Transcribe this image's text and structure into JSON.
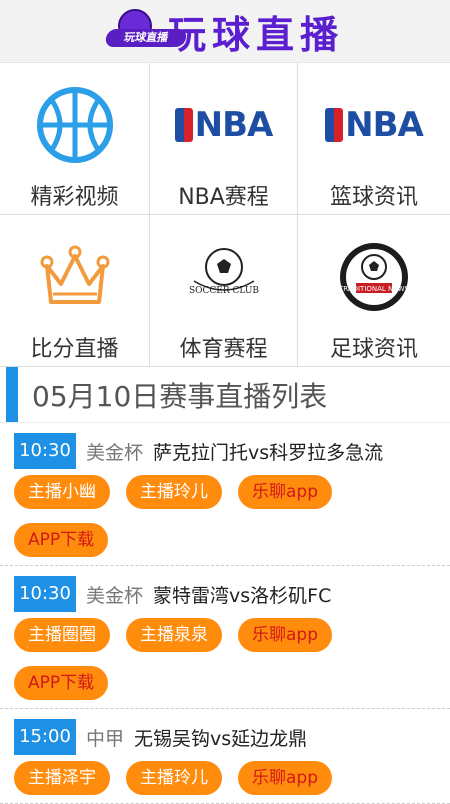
{
  "header": {
    "logo_text": "玩球直播",
    "title": "玩球直播"
  },
  "grid": [
    {
      "label": "精彩视频",
      "icon": "basketball-icon"
    },
    {
      "label": "NBA赛程",
      "icon": "nba-logo-icon",
      "logo_text": "NBA"
    },
    {
      "label": "篮球资讯",
      "icon": "nba-logo-icon",
      "logo_text": "NBA"
    },
    {
      "label": "比分直播",
      "icon": "crown-icon"
    },
    {
      "label": "体育赛程",
      "icon": "soccer-club-icon",
      "badge_text": "SOCCER CLUB"
    },
    {
      "label": "足球资讯",
      "icon": "soccer-news-icon",
      "badge_text": "TRADITIONAL NEWS"
    }
  ],
  "section": {
    "title": "05月10日赛事直播列表"
  },
  "matches": [
    {
      "time": "10:30",
      "league": "美金杯",
      "teams": "萨克拉门托vs科罗拉多急流",
      "tags": [
        "主播小幽",
        "主播玲儿",
        "乐聊app",
        "APP下载"
      ]
    },
    {
      "time": "10:30",
      "league": "美金杯",
      "teams": "蒙特雷湾vs洛杉矶FC",
      "tags": [
        "主播圈圈",
        "主播泉泉",
        "乐聊app",
        "APP下载"
      ]
    },
    {
      "time": "15:00",
      "league": "中甲",
      "teams": "无锡吴钩vs延边龙鼎",
      "tags": [
        "主播泽宇",
        "主播玲儿",
        "乐聊app"
      ]
    }
  ],
  "colors": {
    "accent": "#1e90e6",
    "tag": "#ff8c0d",
    "brand": "#5b1fd0"
  }
}
